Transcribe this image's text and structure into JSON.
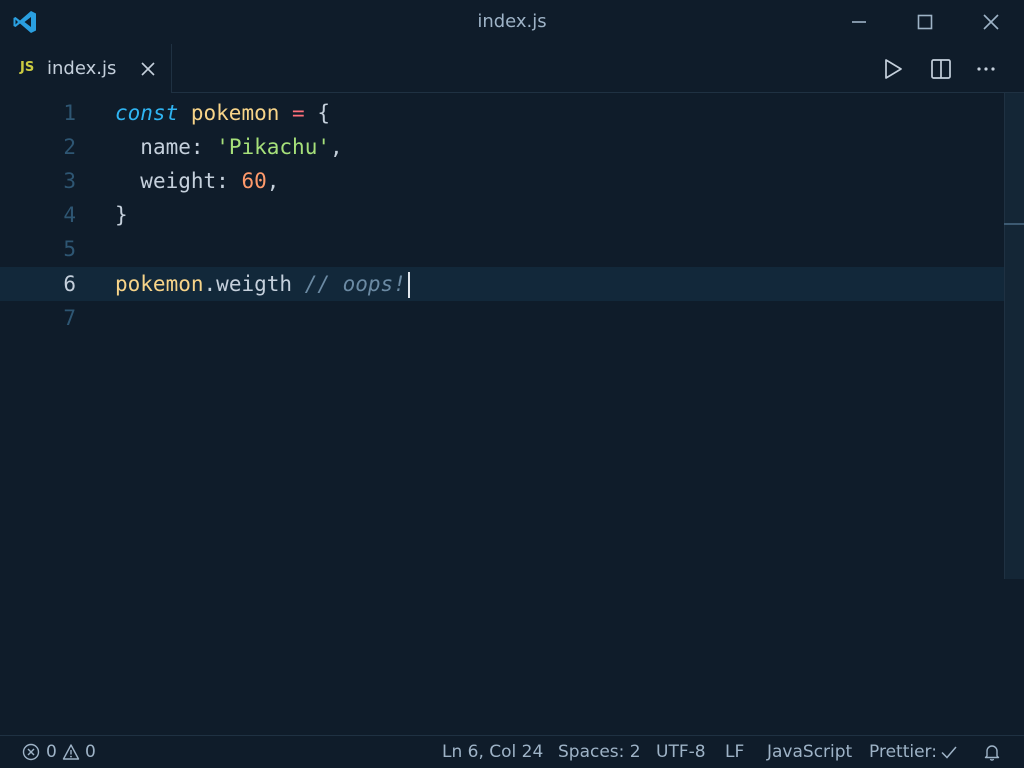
{
  "window": {
    "title": "index.js"
  },
  "tab": {
    "badge": "JS",
    "label": "index.js"
  },
  "code": {
    "lines": [
      {
        "number": "1",
        "tokens": [
          "const",
          "pokemon",
          "=",
          "{"
        ]
      },
      {
        "number": "2",
        "tokens": [
          "name",
          ":",
          "'Pikachu'",
          ","
        ]
      },
      {
        "number": "3",
        "tokens": [
          "weight",
          ":",
          "60",
          ","
        ]
      },
      {
        "number": "4",
        "tokens": [
          "}"
        ]
      },
      {
        "number": "5",
        "tokens": []
      },
      {
        "number": "6",
        "tokens": [
          "pokemon",
          ".",
          "weigth",
          "// oops!"
        ]
      },
      {
        "number": "7",
        "tokens": []
      }
    ],
    "current_line": "6"
  },
  "status": {
    "errors": "0",
    "warnings": "0",
    "position": "Ln 6, Col 24",
    "indent": "Spaces: 2",
    "encoding": "UTF-8",
    "eol": "LF",
    "language": "JavaScript",
    "formatter": "Prettier:"
  },
  "icons": {
    "logo": "vscode-logo-icon",
    "minimize": "minimize-icon",
    "maximize": "maximize-icon",
    "close": "close-icon",
    "run": "play-icon",
    "split": "split-editor-icon",
    "more": "more-actions-icon",
    "error": "error-circle-icon",
    "warning": "warning-triangle-icon",
    "check": "check-icon",
    "bell": "bell-icon"
  },
  "colors": {
    "background": "#0f1c2a",
    "keyword": "#2fb4f2",
    "variable": "#f7d489",
    "string": "#a6e07a",
    "number": "#ff9a6b",
    "operator": "#ff6f7a",
    "comment": "#6b8aa3"
  }
}
